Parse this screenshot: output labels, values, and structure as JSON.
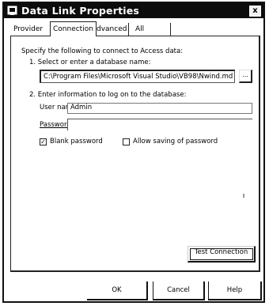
{
  "window": {
    "title": "Data Link Properties",
    "close_label": "x"
  },
  "tabs": {
    "provider": "Provider",
    "connection": "Connection",
    "advanced": "Advanced",
    "all": "All"
  },
  "connection": {
    "intro": "Specify the following to connect to Access data:",
    "step1": "1. Select or enter a database name:",
    "db_name_value": "C:\\Program Files\\Microsoft Visual Studio\\VB98\\Nwind.md",
    "browse_label": "...",
    "step2": "2. Enter information to log on to the database:",
    "user_name_label": "User name:",
    "user_name_value": "Admin",
    "password_label": "Password:",
    "password_value": "",
    "blank_password_label": "Blank password",
    "blank_password_checked": true,
    "allow_saving_label": "Allow saving of password",
    "allow_saving_checked": false,
    "test_connection_label": "Test Connection"
  },
  "buttons": {
    "ok": "OK",
    "cancel": "Cancel",
    "help": "Help"
  }
}
